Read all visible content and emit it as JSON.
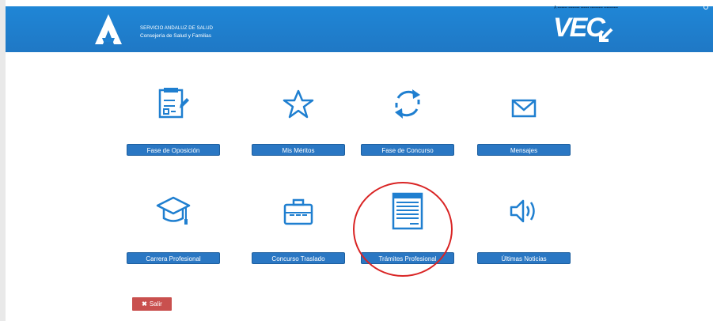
{
  "header": {
    "org_line1": "SERVICIO ANDALUZ DE SALUD",
    "org_line2": "Consejería de Salud y Familias",
    "logo_text": "VEC",
    "top_strip_text": "A ▪▪▪▪▪▪▪ ▪▪▪▪▪▪▪▪ ▪▪▪▪▪▪ ▪▪▪▪▪▪▪▪▪ ▪▪▪▪▪▪▪▪▪▪",
    "brand_color": "#1f80d0"
  },
  "tiles": [
    {
      "label": "Fase de Oposición",
      "icon": "checklist-pencil-icon"
    },
    {
      "label": "Mis Méritos",
      "icon": "star-icon"
    },
    {
      "label": "Fase de Concurso",
      "icon": "refresh-icon"
    },
    {
      "label": "Mensajes",
      "icon": "envelope-icon"
    },
    {
      "label": "Carrera Profesional",
      "icon": "graduation-cap-icon"
    },
    {
      "label": "Concurso Traslado",
      "icon": "briefcase-icon"
    },
    {
      "label": "Trámites Profesional",
      "icon": "document-list-icon"
    },
    {
      "label": "Últimas Noticias",
      "icon": "speaker-icon"
    }
  ],
  "highlight": {
    "target": "Trámites Profesional",
    "color": "#d92424"
  },
  "logout": {
    "label": "Salir",
    "icon": "close-icon"
  }
}
